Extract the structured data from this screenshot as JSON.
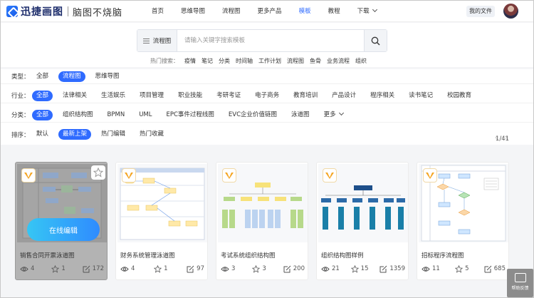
{
  "brand": {
    "name": "迅捷画图",
    "slogan": "脑图不烧脑"
  },
  "nav": {
    "items": [
      {
        "label": "首页"
      },
      {
        "label": "思维导图"
      },
      {
        "label": "流程图"
      },
      {
        "label": "更多产品"
      },
      {
        "label": "模板",
        "active": true
      },
      {
        "label": "教程"
      },
      {
        "label": "下载"
      }
    ],
    "my_files": "我的文件"
  },
  "search": {
    "type_label": "流程图",
    "placeholder": "请输入关键字搜索模板",
    "hot_label": "热门搜索：",
    "hot_terms": [
      "疫情",
      "笔记",
      "分类",
      "时间轴",
      "工作计划",
      "流程图",
      "鱼骨",
      "业务流程",
      "组织"
    ]
  },
  "filters": {
    "type": {
      "label": "类型：",
      "options": [
        "全部",
        "流程图",
        "思维导图"
      ],
      "selected": 1
    },
    "industry": {
      "label": "行业：",
      "options": [
        "全部",
        "法律相关",
        "生活娱乐",
        "项目管理",
        "职业技能",
        "考研考证",
        "电子商务",
        "教育培训",
        "产品设计",
        "程序相关",
        "读书笔记",
        "校园教育"
      ],
      "selected": 0
    },
    "category": {
      "label": "分类：",
      "options": [
        "全部",
        "组织结构图",
        "BPMN",
        "UML",
        "EPC事件过程线图",
        "EVC企业价值链图",
        "泳道图",
        "更多"
      ],
      "selected": 0
    },
    "sort": {
      "label": "排序：",
      "options": [
        "默认",
        "最新上架",
        "热门编辑",
        "热门收藏"
      ],
      "selected": 1
    }
  },
  "pagination": {
    "current": 1,
    "total": 41,
    "text": "1/41",
    "prev": "‹",
    "next": "›"
  },
  "cards": [
    {
      "title": "销售合同开票泳道图",
      "views": "4",
      "likes": "1",
      "edits": "172",
      "hover": true,
      "edit_label": "在线编辑"
    },
    {
      "title": "财务系统管理泳道图",
      "views": "4",
      "likes": "1",
      "edits": "97"
    },
    {
      "title": "考试系统组织结构图",
      "views": "3",
      "likes": "3",
      "edits": "200"
    },
    {
      "title": "组织结构图样例",
      "views": "21",
      "likes": "15",
      "edits": "1359"
    },
    {
      "title": "招标程序流程图",
      "views": "11",
      "likes": "5",
      "edits": "685"
    }
  ],
  "feedback": {
    "label": "帮助反馈"
  },
  "colors": {
    "accent": "#2f6bff",
    "vip": "#f5a623",
    "edit_gradient_start": "#36c6f4",
    "edit_gradient_end": "#2f8bff"
  }
}
